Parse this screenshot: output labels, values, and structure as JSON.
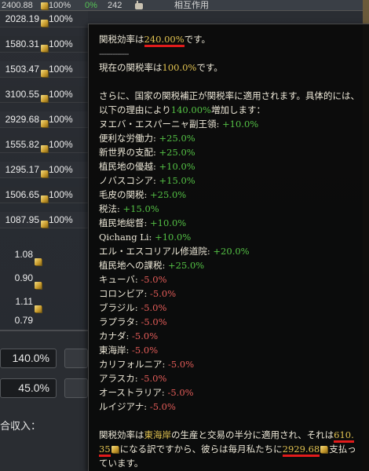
{
  "header": {
    "amount": "2400.88",
    "pct": "100%",
    "green_pct": "0%",
    "count": "242",
    "interact_label": "相互作用"
  },
  "ledger_rows": [
    {
      "amount": "2400.88",
      "pct": "100%"
    },
    {
      "amount": "2028.19",
      "pct": "100%"
    },
    {
      "amount": "1580.31",
      "pct": "100%"
    },
    {
      "amount": "1503.47",
      "pct": "100%"
    },
    {
      "amount": "3100.55",
      "pct": "100%"
    },
    {
      "amount": "2929.68",
      "pct": "100%"
    },
    {
      "amount": "1555.82",
      "pct": "100%"
    },
    {
      "amount": "1295.17",
      "pct": "100%"
    },
    {
      "amount": "1506.65",
      "pct": "100%"
    },
    {
      "amount": "1087.95",
      "pct": "100%"
    }
  ],
  "small_rows": [
    {
      "amount": "1.08"
    },
    {
      "amount": "0.90"
    },
    {
      "amount": "1.11"
    },
    {
      "amount": "0.79"
    }
  ],
  "lower_panel": {
    "box1": "140.0%",
    "box2": "45.0%",
    "income_label": "合収入："
  },
  "tooltip": {
    "line1_pre": "関税効率は",
    "line1_value": "240.00%",
    "line1_post": "です。",
    "divider": "-------------",
    "line2_pre": "現在の関税率は",
    "line2_value": "100.0%",
    "line2_post": "です。",
    "para_a": "さらに、国家の関税補正が関税率に適用されます。具体的には、",
    "para_b_pre": "以下の理由により",
    "para_b_value": "140.00%",
    "para_b_post": "増加します：",
    "modifiers": [
      {
        "name": "ヌエバ・エスパーニャ副王領:",
        "value": "+10.0%",
        "sign": "pos"
      },
      {
        "name": "便利な労働力:",
        "value": "+25.0%",
        "sign": "pos"
      },
      {
        "name": "新世界の支配:",
        "value": "+25.0%",
        "sign": "pos"
      },
      {
        "name": "植民地の優越:",
        "value": "+10.0%",
        "sign": "pos"
      },
      {
        "name": "ノバスコシア:",
        "value": "+15.0%",
        "sign": "pos"
      },
      {
        "name": "毛皮の関税:",
        "value": "+25.0%",
        "sign": "pos"
      },
      {
        "name": "税法:",
        "value": "+15.0%",
        "sign": "pos"
      },
      {
        "name": "植民地総督:",
        "value": "+10.0%",
        "sign": "pos"
      },
      {
        "name": "Qichang Li:",
        "value": "+10.0%",
        "sign": "pos"
      },
      {
        "name": "エル・エスコリアル修道院:",
        "value": "+20.0%",
        "sign": "pos"
      },
      {
        "name": "植民地への課税:",
        "value": "+25.0%",
        "sign": "pos"
      },
      {
        "name": "キューバ:",
        "value": "-5.0%",
        "sign": "neg"
      },
      {
        "name": "コロンビア:",
        "value": "-5.0%",
        "sign": "neg"
      },
      {
        "name": "ブラジル:",
        "value": "-5.0%",
        "sign": "neg"
      },
      {
        "name": "ラプラタ:",
        "value": "-5.0%",
        "sign": "neg"
      },
      {
        "name": "カナダ:",
        "value": "-5.0%",
        "sign": "neg"
      },
      {
        "name": "東海岸:",
        "value": "-5.0%",
        "sign": "neg"
      },
      {
        "name": "カリフォルニア:",
        "value": "-5.0%",
        "sign": "neg"
      },
      {
        "name": "アラスカ:",
        "value": "-5.0%",
        "sign": "neg"
      },
      {
        "name": "オーストラリア:",
        "value": "-5.0%",
        "sign": "neg"
      },
      {
        "name": "ルイジアナ:",
        "value": "-5.0%",
        "sign": "neg"
      }
    ],
    "final_a1": "関税効率は",
    "final_a2": "東海岸",
    "final_a3": "の生産と交易の半分に適用され、それは",
    "final_a4": "610.",
    "final_b1": "35",
    "final_b2": "になる訳ですから、彼らは毎月私たちに",
    "final_b3": "2929.68",
    "final_b4": "支払っ",
    "final_c": "ています。"
  },
  "colors": {
    "accent": "#e1c250",
    "positive": "#54c145",
    "negative": "#e35c58",
    "highlight_underline": "#e11b1b"
  },
  "icons": [
    "coin-icon",
    "hand-icon",
    "crossed-swords-icon",
    "trade-icon"
  ]
}
